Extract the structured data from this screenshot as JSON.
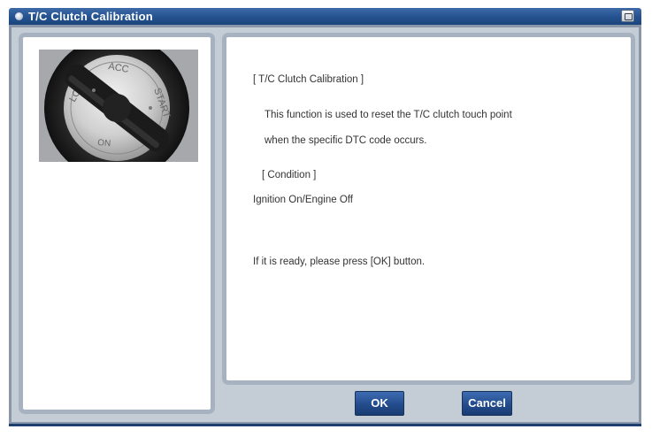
{
  "window": {
    "title": "T/C Clutch Calibration",
    "title_icon": "circle-icon",
    "title_button_icon": "screen-capture-icon"
  },
  "image": {
    "subject": "ignition-key-switch",
    "switch_labels": [
      "LOCK",
      "ACC",
      "START",
      "ON"
    ]
  },
  "message": {
    "heading": "[ T/C Clutch Calibration ]",
    "line1": "This function is used to reset the T/C clutch touch point",
    "line2": "when the specific DTC code occurs.",
    "condition_heading": "[ Condition ]",
    "condition_text": "Ignition On/Engine Off",
    "prompt": "If it is ready, please press [OK] button."
  },
  "buttons": {
    "ok": "OK",
    "cancel": "Cancel"
  },
  "colors": {
    "titlebar": "#24528f",
    "button": "#234c8c",
    "panel_border": "#a7b2c0",
    "background": "#c4cdd6"
  }
}
